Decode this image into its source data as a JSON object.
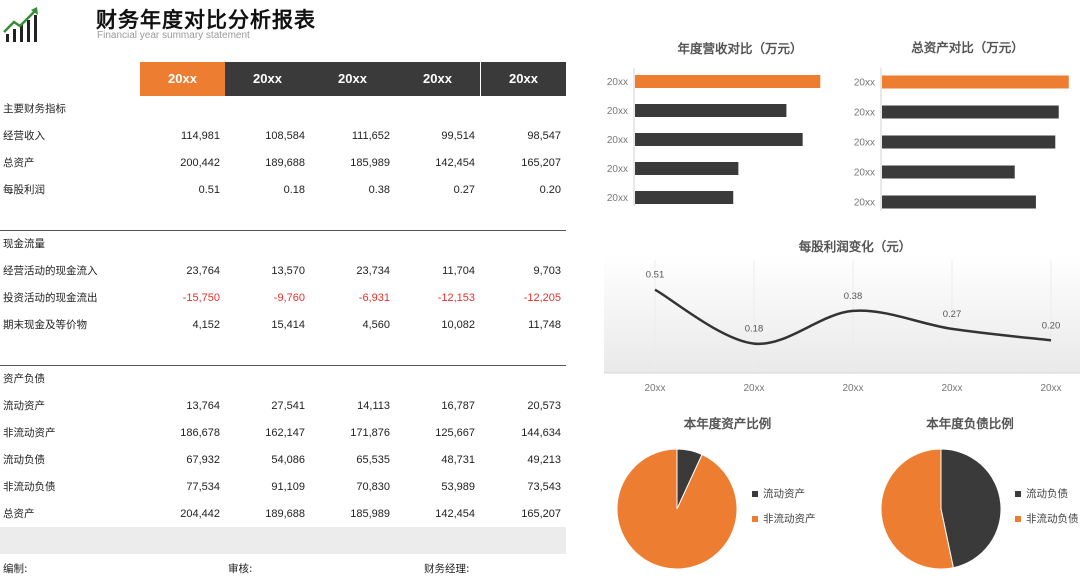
{
  "header": {
    "title": "财务年度对比分析报表",
    "subtitle": "Financial year summary statement"
  },
  "table": {
    "columns": [
      "20xx",
      "20xx",
      "20xx",
      "20xx",
      "20xx"
    ],
    "sections": [
      {
        "heading": "主要财务指标",
        "rows": [
          {
            "label": "经营收入",
            "values": [
              "114,981",
              "108,584",
              "111,652",
              "99,514",
              "98,547"
            ]
          },
          {
            "label": "总资产",
            "values": [
              "200,442",
              "189,688",
              "185,989",
              "142,454",
              "165,207"
            ]
          },
          {
            "label": "每股利润",
            "values": [
              "0.51",
              "0.18",
              "0.38",
              "0.27",
              "0.20"
            ]
          }
        ]
      },
      {
        "heading": "现金流量",
        "rows": [
          {
            "label": "经营活动的现金流入",
            "values": [
              "23,764",
              "13,570",
              "23,734",
              "11,704",
              "9,703"
            ]
          },
          {
            "label": "投资活动的现金流出",
            "values": [
              "-15,750",
              "-9,760",
              "-6,931",
              "-12,153",
              "-12,205"
            ]
          },
          {
            "label": "期末现金及等价物",
            "values": [
              "4,152",
              "15,414",
              "4,560",
              "10,082",
              "11,748"
            ]
          }
        ]
      },
      {
        "heading": "资产负债",
        "rows": [
          {
            "label": "流动资产",
            "values": [
              "13,764",
              "27,541",
              "14,113",
              "16,787",
              "20,573"
            ]
          },
          {
            "label": "非流动资产",
            "values": [
              "186,678",
              "162,147",
              "171,876",
              "125,667",
              "144,634"
            ]
          },
          {
            "label": "流动负债",
            "values": [
              "67,932",
              "54,086",
              "65,535",
              "48,731",
              "49,213"
            ]
          },
          {
            "label": "非流动负债",
            "values": [
              "77,534",
              "91,109",
              "70,830",
              "53,989",
              "73,543"
            ]
          },
          {
            "label": "总资产",
            "values": [
              "204,442",
              "189,688",
              "185,989",
              "142,454",
              "165,207"
            ]
          }
        ]
      }
    ]
  },
  "footer": {
    "editor": "编制:",
    "reviewer": "审核:",
    "manager": "财务经理:"
  },
  "colors": {
    "accent": "#ed7d31",
    "dark": "#3a3a3a",
    "negative": "#e8302c"
  },
  "chart_data": [
    {
      "type": "bar",
      "orientation": "horizontal",
      "title": "年度营收对比（万元）",
      "categories": [
        "20xx",
        "20xx",
        "20xx",
        "20xx",
        "20xx"
      ],
      "values": [
        114981,
        108584,
        111652,
        99514,
        98547
      ],
      "highlight_index": 0,
      "xlim": [
        80000,
        117000
      ]
    },
    {
      "type": "bar",
      "orientation": "horizontal",
      "title": "总资产对比（万元）",
      "categories": [
        "20xx",
        "20xx",
        "20xx",
        "20xx",
        "20xx"
      ],
      "values": [
        200442,
        189688,
        185989,
        142454,
        165207
      ],
      "highlight_index": 0,
      "xlim": [
        0,
        205000
      ]
    },
    {
      "type": "line",
      "title": "每股利润变化（元）",
      "categories": [
        "20xx",
        "20xx",
        "20xx",
        "20xx",
        "20xx"
      ],
      "values": [
        0.51,
        0.18,
        0.38,
        0.27,
        0.2
      ],
      "data_labels": [
        "0.51",
        "0.18",
        "0.38",
        "0.27",
        "0.20"
      ],
      "ylim": [
        0,
        0.6
      ],
      "smooth": true
    },
    {
      "type": "pie",
      "title": "本年度资产比例",
      "labels": [
        "流动资产",
        "非流动资产"
      ],
      "values": [
        13764,
        186678
      ],
      "colors": [
        "#3a3a3a",
        "#ed7d31"
      ],
      "legend": "right"
    },
    {
      "type": "pie",
      "title": "本年度负债比例",
      "labels": [
        "流动负债",
        "非流动负债"
      ],
      "values": [
        67932,
        77534
      ],
      "colors": [
        "#3a3a3a",
        "#ed7d31"
      ],
      "legend": "right"
    }
  ]
}
